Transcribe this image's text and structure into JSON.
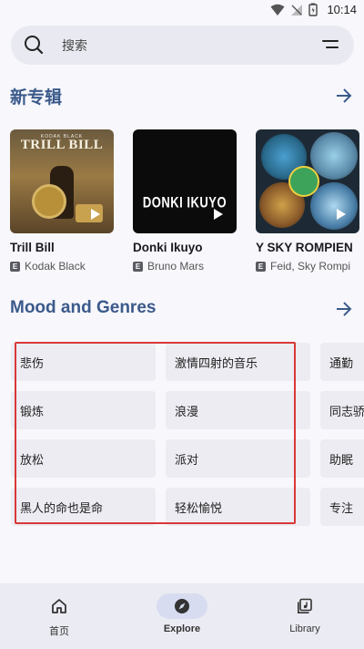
{
  "status_bar": {
    "time": "10:14"
  },
  "search": {
    "placeholder": "搜索"
  },
  "new_albums": {
    "title": "新专辑",
    "albums": [
      {
        "title": "Trill Bill",
        "artist": "Kodak Black",
        "explicit": "E",
        "cover_text_top": "KODAK BLACK",
        "cover_text": "TRILL BILL"
      },
      {
        "title": "Donki Ikuyo",
        "artist": "Bruno Mars",
        "explicit": "E",
        "cover_text": "DONKI IKUYO"
      },
      {
        "title": "Y SKY ROMPIEN",
        "artist": "Feid, Sky Rompi",
        "explicit": "E"
      }
    ]
  },
  "moods": {
    "title": "Mood and Genres",
    "rows": [
      [
        "悲伤",
        "激情四射的音乐",
        "通勤"
      ],
      [
        "锻炼",
        "浪漫",
        "同志骄"
      ],
      [
        "放松",
        "派对",
        "助眠"
      ],
      [
        "黑人的命也是命",
        "轻松愉悦",
        "专注"
      ]
    ]
  },
  "nav": [
    {
      "label": "首页",
      "icon": "home-icon",
      "active": false
    },
    {
      "label": "Explore",
      "icon": "compass-icon",
      "active": true
    },
    {
      "label": "Library",
      "icon": "library-icon",
      "active": false
    }
  ],
  "colors": {
    "accent": "#3b5a8a",
    "highlight": "#d93838",
    "background": "#f7f7fc"
  }
}
